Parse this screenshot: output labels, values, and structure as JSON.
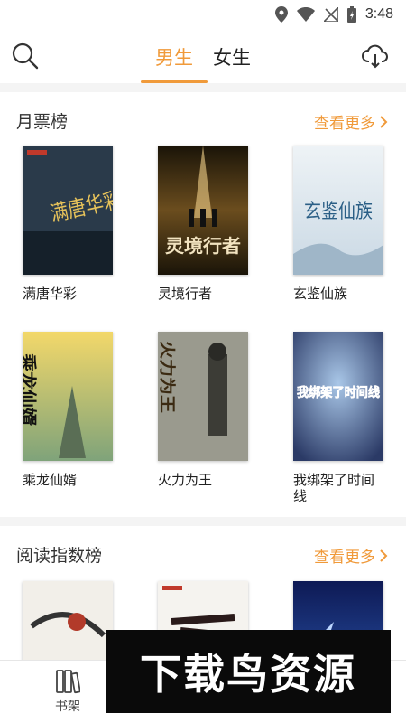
{
  "status_bar": {
    "time": "3:48"
  },
  "header": {
    "tabs": [
      {
        "label": "男生",
        "active": true
      },
      {
        "label": "女生",
        "active": false
      }
    ]
  },
  "sections": [
    {
      "title": "月票榜",
      "more_label": "查看更多",
      "books": [
        {
          "title": "满唐华彩",
          "cover_text": "满唐华彩"
        },
        {
          "title": "灵境行者",
          "cover_text": "灵境行者"
        },
        {
          "title": "玄鉴仙族",
          "cover_text": "玄鉴仙族"
        },
        {
          "title": "乘龙仙婿",
          "cover_text": "乘龙仙婿"
        },
        {
          "title": "火力为王",
          "cover_text": "火力为王"
        },
        {
          "title": "我绑架了时间线",
          "cover_text": "我绑架了时间线"
        }
      ]
    },
    {
      "title": "阅读指数榜",
      "more_label": "查看更多",
      "books": []
    }
  ],
  "bottom_nav": {
    "items": [
      {
        "label": "书架",
        "icon": "bookshelf-icon"
      }
    ]
  },
  "watermark": {
    "text": "下载鸟资源"
  },
  "colors": {
    "accent": "#f09a3a",
    "section_bg": "#f4f4f4"
  }
}
